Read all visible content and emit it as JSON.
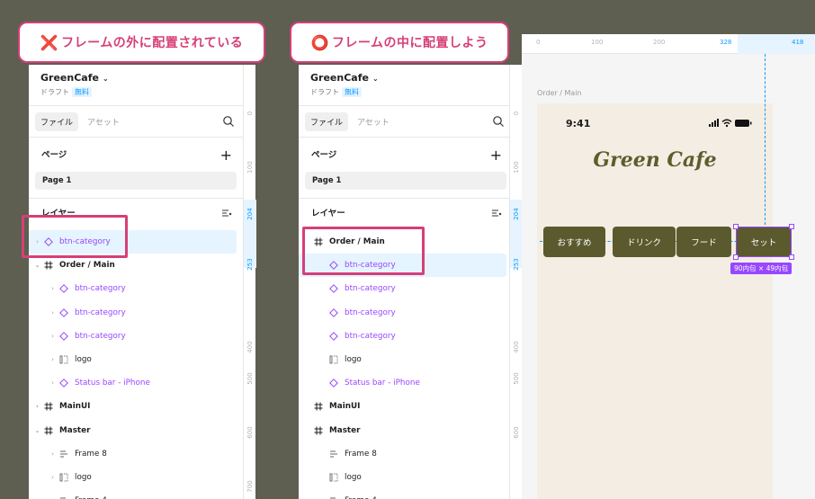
{
  "callouts": {
    "wrong": {
      "mark": "❌",
      "text": "フレームの外に配置されている"
    },
    "right": {
      "mark": "⭕",
      "text": "フレームの中に配置しよう"
    }
  },
  "project": {
    "name": "GreenCafe",
    "draft": "ドラフト",
    "badge": "無料"
  },
  "tabs": {
    "file": "ファイル",
    "assets": "アセット"
  },
  "pages": {
    "title": "ページ",
    "page1": "Page 1"
  },
  "layers_title": "レイヤー",
  "left_layers": [
    {
      "label": "btn-category",
      "type": "component",
      "indent": 0,
      "arrow": "›"
    },
    {
      "label": "Order / Main",
      "type": "frame",
      "indent": 0,
      "arrow": "⌄"
    },
    {
      "label": "btn-category",
      "type": "component",
      "indent": 1,
      "arrow": "›"
    },
    {
      "label": "btn-category",
      "type": "component",
      "indent": 1,
      "arrow": "›"
    },
    {
      "label": "btn-category",
      "type": "component",
      "indent": 1,
      "arrow": "›"
    },
    {
      "label": "logo",
      "type": "group",
      "indent": 1,
      "arrow": "›"
    },
    {
      "label": "Status bar - iPhone",
      "type": "component",
      "indent": 1,
      "arrow": "›"
    },
    {
      "label": "MainUI",
      "type": "frame",
      "indent": 0,
      "arrow": "›"
    },
    {
      "label": "Master",
      "type": "frame",
      "indent": 0,
      "arrow": "⌄"
    },
    {
      "label": "Frame 8",
      "type": "autolayout",
      "indent": 1,
      "arrow": "›"
    },
    {
      "label": "logo",
      "type": "group",
      "indent": 1,
      "arrow": "›"
    },
    {
      "label": "Frame 4",
      "type": "autolayout",
      "indent": 1,
      "arrow": "›"
    }
  ],
  "right_layers": [
    {
      "label": "Order / Main",
      "type": "frame",
      "indent": 0,
      "arrow": ""
    },
    {
      "label": "btn-category",
      "type": "component",
      "indent": 1,
      "arrow": ""
    },
    {
      "label": "btn-category",
      "type": "component",
      "indent": 1,
      "arrow": ""
    },
    {
      "label": "btn-category",
      "type": "component",
      "indent": 1,
      "arrow": ""
    },
    {
      "label": "btn-category",
      "type": "component",
      "indent": 1,
      "arrow": ""
    },
    {
      "label": "logo",
      "type": "group",
      "indent": 1,
      "arrow": ""
    },
    {
      "label": "Status bar - iPhone",
      "type": "component",
      "indent": 1,
      "arrow": ""
    },
    {
      "label": "MainUI",
      "type": "frame",
      "indent": 0,
      "arrow": ""
    },
    {
      "label": "Master",
      "type": "frame",
      "indent": 0,
      "arrow": ""
    },
    {
      "label": "Frame 8",
      "type": "autolayout",
      "indent": 1,
      "arrow": ""
    },
    {
      "label": "logo",
      "type": "group",
      "indent": 1,
      "arrow": ""
    },
    {
      "label": "Frame 4",
      "type": "autolayout",
      "indent": 1,
      "arrow": ""
    }
  ],
  "left_ruler": [
    "0",
    "100",
    "204",
    "253",
    "400",
    "500",
    "600",
    "700"
  ],
  "right_ruler": [
    "0",
    "100",
    "204",
    "253",
    "400",
    "500",
    "600"
  ],
  "h_ruler": [
    "0",
    "100",
    "200",
    "328",
    "418"
  ],
  "canvas": {
    "frame_label": "Order / Main",
    "time": "9:41",
    "brand": "Green Cafe",
    "buttons": [
      "おすすめ",
      "ドリンク",
      "フード",
      "セット"
    ],
    "size_tag": "90内包 × 49内包"
  },
  "colors": {
    "accent": "#d63f77",
    "component": "#9747ff",
    "selection": "#0d99ff",
    "button": "#5a5a2e",
    "brand": "#5a5e2d"
  }
}
